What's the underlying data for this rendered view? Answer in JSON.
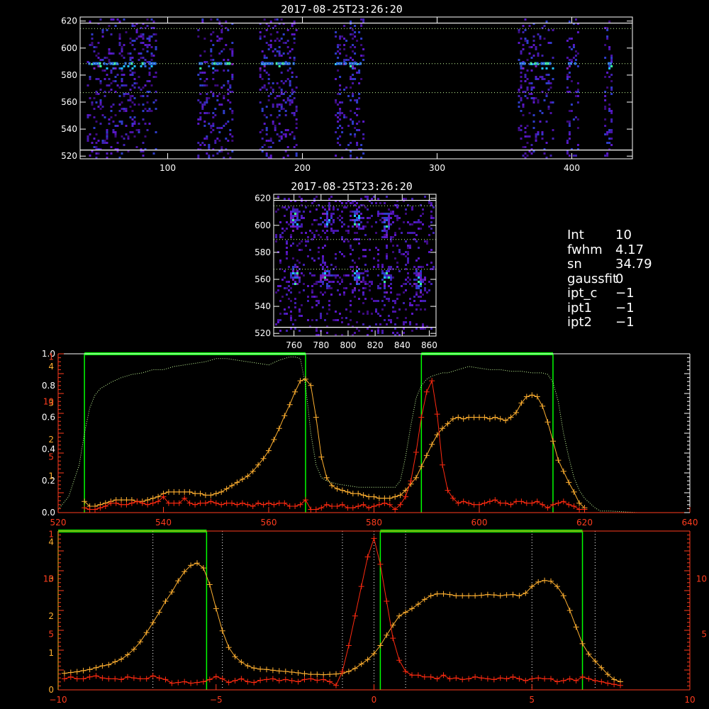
{
  "colors": {
    "background": "#000000",
    "axes": "#ffffff",
    "axes_red": "#ff3c1e",
    "series_red": "#ff2a10",
    "series_orange": "#ffb030",
    "band_green": "#00ff00",
    "dotted_green": "#c8ff9c",
    "dotted_white": "#ffffff"
  },
  "info": [
    {
      "key": "Int",
      "value": "10"
    },
    {
      "key": "fwhm",
      "value": "4.17"
    },
    {
      "key": "sn",
      "value": "34.79"
    },
    {
      "key": "gaussfit",
      "value": "0"
    },
    {
      "key": "ipt_c",
      "value": "−1"
    },
    {
      "key": "ipt1",
      "value": "−1"
    },
    {
      "key": "ipt2",
      "value": "−1"
    }
  ],
  "chart_data": [
    {
      "type": "heatmap",
      "title": "2017-08-25T23:26:20",
      "xlim": [
        35,
        445
      ],
      "ylim": [
        518,
        623
      ],
      "xticks": [
        "100",
        "200",
        "300",
        "400"
      ],
      "yticks": [
        "520",
        "540",
        "560",
        "580",
        "600",
        "620"
      ],
      "hlines_solid": [
        618.5,
        524.5
      ],
      "hlines_dotted": [
        614.5,
        588.5,
        567
      ],
      "active_columns": [
        [
          40,
          92
        ],
        [
          122,
          148
        ],
        [
          168,
          196
        ],
        [
          224,
          245
        ],
        [
          360,
          386
        ],
        [
          396,
          404
        ],
        [
          424,
          430
        ]
      ],
      "bright_row": 587.5
    },
    {
      "type": "heatmap",
      "title": "2017-08-25T23:26:20",
      "xlim": [
        745,
        865
      ],
      "ylim": [
        518,
        623
      ],
      "xticks": [
        "760",
        "780",
        "800",
        "820",
        "840",
        "860"
      ],
      "yticks": [
        "520",
        "540",
        "560",
        "580",
        "600",
        "620"
      ],
      "hlines_solid": [
        618.5,
        524.5
      ],
      "hlines_dotted": [
        614.5,
        589.5,
        567.5
      ]
    },
    {
      "type": "line",
      "xlim": [
        520,
        640
      ],
      "xticks": [
        "520",
        "540",
        "560",
        "580",
        "600",
        "620",
        "640"
      ],
      "left_axis_ticks": [
        "0.0",
        "0.2",
        "0.4",
        "0.6",
        "0.8",
        "1.0"
      ],
      "left_axis_ticks_orange": [
        "1",
        "2",
        "3",
        "4"
      ],
      "left_axis_ticks_red": [
        "5",
        "10",
        "1"
      ],
      "green_band_1": [
        525,
        567
      ],
      "green_band_2": [
        589,
        614
      ],
      "series": [
        {
          "color": "orange",
          "x": [
            525,
            526,
            527,
            528,
            529,
            530,
            531,
            532,
            533,
            534,
            535,
            536,
            537,
            538,
            539,
            540,
            541,
            542,
            543,
            544,
            545,
            546,
            547,
            548,
            549,
            550,
            551,
            552,
            553,
            554,
            555,
            556,
            557,
            558,
            559,
            560,
            561,
            562,
            563,
            564,
            565,
            566,
            567,
            568,
            569,
            570,
            571,
            572,
            573,
            574,
            575,
            576,
            577,
            578,
            579,
            580,
            581,
            582,
            583,
            584,
            585,
            586,
            587,
            588,
            589,
            590,
            591,
            592,
            593,
            594,
            595,
            596,
            597,
            598,
            599,
            600,
            601,
            602,
            603,
            604,
            605,
            606,
            607,
            608,
            609,
            610,
            611,
            612,
            613,
            614,
            615,
            616,
            617,
            618,
            619,
            620
          ],
          "y": [
            0.07,
            0.04,
            0.04,
            0.05,
            0.06,
            0.07,
            0.08,
            0.08,
            0.08,
            0.08,
            0.07,
            0.07,
            0.08,
            0.09,
            0.1,
            0.12,
            0.13,
            0.13,
            0.13,
            0.13,
            0.13,
            0.12,
            0.12,
            0.11,
            0.11,
            0.12,
            0.13,
            0.15,
            0.17,
            0.19,
            0.21,
            0.23,
            0.26,
            0.3,
            0.34,
            0.39,
            0.46,
            0.53,
            0.61,
            0.68,
            0.76,
            0.83,
            0.84,
            0.8,
            0.6,
            0.35,
            0.22,
            0.17,
            0.15,
            0.14,
            0.13,
            0.12,
            0.12,
            0.11,
            0.1,
            0.1,
            0.09,
            0.09,
            0.09,
            0.1,
            0.11,
            0.14,
            0.18,
            0.22,
            0.29,
            0.36,
            0.43,
            0.49,
            0.53,
            0.56,
            0.59,
            0.6,
            0.59,
            0.6,
            0.6,
            0.6,
            0.6,
            0.59,
            0.6,
            0.59,
            0.58,
            0.6,
            0.63,
            0.69,
            0.73,
            0.74,
            0.73,
            0.67,
            0.57,
            0.45,
            0.33,
            0.26,
            0.19,
            0.13,
            0.06,
            0.03
          ]
        },
        {
          "color": "red",
          "x": [
            525,
            526,
            527,
            528,
            529,
            530,
            531,
            532,
            533,
            534,
            535,
            536,
            537,
            538,
            539,
            540,
            541,
            542,
            543,
            544,
            545,
            546,
            547,
            548,
            549,
            550,
            551,
            552,
            553,
            554,
            555,
            556,
            557,
            558,
            559,
            560,
            561,
            562,
            563,
            564,
            565,
            566,
            567,
            568,
            569,
            570,
            571,
            572,
            573,
            574,
            575,
            576,
            577,
            578,
            579,
            580,
            581,
            582,
            583,
            584,
            585,
            586,
            587,
            588,
            589,
            590,
            591,
            592,
            593,
            594,
            595,
            596,
            597,
            598,
            599,
            600,
            601,
            602,
            603,
            604,
            605,
            606,
            607,
            608,
            609,
            610,
            611,
            612,
            613,
            614,
            615,
            616,
            617,
            618,
            619,
            620
          ],
          "y": [
            0.03,
            0.02,
            0.02,
            0.03,
            0.04,
            0.06,
            0.06,
            0.05,
            0.05,
            0.06,
            0.07,
            0.06,
            0.05,
            0.06,
            0.07,
            0.1,
            0.06,
            0.06,
            0.06,
            0.09,
            0.06,
            0.05,
            0.06,
            0.06,
            0.07,
            0.06,
            0.05,
            0.06,
            0.06,
            0.05,
            0.06,
            0.05,
            0.04,
            0.06,
            0.05,
            0.06,
            0.05,
            0.06,
            0.06,
            0.04,
            0.04,
            0.05,
            0.08,
            0.02,
            0.02,
            0.03,
            0.05,
            0.04,
            0.04,
            0.05,
            0.03,
            0.03,
            0.04,
            0.05,
            0.03,
            0.04,
            0.05,
            0.06,
            0.05,
            0.02,
            0.05,
            0.1,
            0.2,
            0.38,
            0.6,
            0.76,
            0.83,
            0.62,
            0.3,
            0.14,
            0.09,
            0.06,
            0.07,
            0.06,
            0.05,
            0.05,
            0.06,
            0.07,
            0.08,
            0.06,
            0.06,
            0.05,
            0.07,
            0.07,
            0.06,
            0.06,
            0.07,
            0.05,
            0.03,
            0.05,
            0.06,
            0.07,
            0.05,
            0.04,
            0.02,
            0.02
          ]
        },
        {
          "color": "dotted",
          "x": [
            520,
            522,
            524,
            525,
            526,
            527,
            528,
            529,
            530,
            532,
            534,
            536,
            538,
            540,
            542,
            544,
            546,
            548,
            550,
            552,
            554,
            556,
            558,
            560,
            562,
            564,
            565,
            566,
            567,
            568,
            569,
            570,
            571,
            572,
            573,
            575,
            577,
            580,
            582,
            584,
            585,
            586,
            587,
            588,
            589,
            590,
            591,
            592,
            593,
            594,
            596,
            598,
            600,
            602,
            604,
            606,
            608,
            610,
            612,
            613,
            614,
            615,
            616,
            617,
            618,
            619,
            620,
            621,
            622,
            623,
            625,
            630,
            635,
            640
          ],
          "y": [
            0.02,
            0.1,
            0.3,
            0.5,
            0.66,
            0.74,
            0.78,
            0.8,
            0.82,
            0.85,
            0.87,
            0.88,
            0.9,
            0.9,
            0.92,
            0.93,
            0.94,
            0.95,
            0.97,
            0.97,
            0.96,
            0.95,
            0.94,
            0.93,
            0.96,
            0.98,
            0.98,
            0.97,
            0.8,
            0.5,
            0.3,
            0.22,
            0.2,
            0.19,
            0.18,
            0.17,
            0.16,
            0.16,
            0.16,
            0.16,
            0.2,
            0.35,
            0.55,
            0.72,
            0.8,
            0.84,
            0.86,
            0.87,
            0.88,
            0.88,
            0.9,
            0.92,
            0.91,
            0.9,
            0.9,
            0.89,
            0.89,
            0.88,
            0.88,
            0.87,
            0.82,
            0.7,
            0.5,
            0.35,
            0.22,
            0.14,
            0.09,
            0.06,
            0.03,
            0.01,
            0.01,
            0.0,
            0.0,
            0.0
          ]
        }
      ]
    },
    {
      "type": "line",
      "xlim": [
        -10,
        10
      ],
      "xticks": [
        "−10",
        "−5",
        "0",
        "5",
        "10"
      ],
      "left_axis_ticks": [
        "0",
        "1",
        "2",
        "3",
        "4"
      ],
      "left_axis_ticks_red": [
        "5",
        "10",
        "1"
      ],
      "right_axis_ticks_red": [
        "5",
        "10"
      ],
      "green_band_1": [
        -10,
        -5.3
      ],
      "green_band_2": [
        0.2,
        6.6
      ],
      "vlines_dotted": [
        -7,
        -4.8,
        -1,
        0,
        1,
        5,
        7
      ],
      "series": [
        {
          "color": "orange",
          "x": [
            -9.8,
            -9.6,
            -9.4,
            -9.2,
            -9.0,
            -8.8,
            -8.6,
            -8.4,
            -8.2,
            -8.0,
            -7.8,
            -7.6,
            -7.4,
            -7.2,
            -7.0,
            -6.8,
            -6.6,
            -6.4,
            -6.2,
            -6.0,
            -5.8,
            -5.6,
            -5.4,
            -5.2,
            -5.0,
            -4.8,
            -4.6,
            -4.4,
            -4.2,
            -4.0,
            -3.8,
            -3.6,
            -3.4,
            -3.2,
            -3.0,
            -2.8,
            -2.6,
            -2.4,
            -2.2,
            -2.0,
            -1.8,
            -1.6,
            -1.4,
            -1.2,
            -1.0,
            -0.8,
            -0.6,
            -0.4,
            -0.2,
            0.0,
            0.2,
            0.4,
            0.6,
            0.8,
            1.0,
            1.2,
            1.4,
            1.6,
            1.8,
            2.0,
            2.2,
            2.4,
            2.6,
            2.8,
            3.0,
            3.2,
            3.4,
            3.6,
            3.8,
            4.0,
            4.2,
            4.4,
            4.6,
            4.8,
            5.0,
            5.2,
            5.4,
            5.6,
            5.8,
            6.0,
            6.2,
            6.4,
            6.6,
            6.8,
            7.0,
            7.2,
            7.4,
            7.6,
            7.8
          ],
          "y": [
            0.45,
            0.47,
            0.49,
            0.52,
            0.55,
            0.6,
            0.65,
            0.68,
            0.76,
            0.83,
            0.95,
            1.1,
            1.3,
            1.55,
            1.82,
            2.1,
            2.4,
            2.65,
            2.95,
            3.2,
            3.37,
            3.43,
            3.3,
            2.85,
            2.2,
            1.6,
            1.15,
            0.9,
            0.75,
            0.65,
            0.59,
            0.56,
            0.55,
            0.53,
            0.51,
            0.5,
            0.48,
            0.46,
            0.44,
            0.42,
            0.42,
            0.41,
            0.42,
            0.43,
            0.45,
            0.5,
            0.58,
            0.7,
            0.82,
            0.98,
            1.2,
            1.48,
            1.75,
            2.0,
            2.1,
            2.2,
            2.32,
            2.45,
            2.55,
            2.6,
            2.6,
            2.58,
            2.55,
            2.55,
            2.55,
            2.55,
            2.56,
            2.58,
            2.57,
            2.55,
            2.57,
            2.58,
            2.55,
            2.62,
            2.8,
            2.92,
            2.96,
            2.94,
            2.8,
            2.55,
            2.15,
            1.7,
            1.25,
            0.97,
            0.78,
            0.6,
            0.42,
            0.28,
            0.22
          ]
        },
        {
          "color": "red",
          "x": [
            -9.8,
            -9.6,
            -9.4,
            -9.2,
            -9.0,
            -8.8,
            -8.6,
            -8.4,
            -8.2,
            -8.0,
            -7.8,
            -7.6,
            -7.4,
            -7.2,
            -7.0,
            -6.8,
            -6.6,
            -6.4,
            -6.2,
            -6.0,
            -5.8,
            -5.6,
            -5.4,
            -5.2,
            -5.0,
            -4.8,
            -4.6,
            -4.4,
            -4.2,
            -4.0,
            -3.8,
            -3.6,
            -3.4,
            -3.2,
            -3.0,
            -2.8,
            -2.6,
            -2.4,
            -2.2,
            -2.0,
            -1.8,
            -1.6,
            -1.4,
            -1.2,
            -1.0,
            -0.8,
            -0.6,
            -0.4,
            -0.2,
            0.0,
            0.2,
            0.4,
            0.6,
            0.8,
            1.0,
            1.2,
            1.4,
            1.6,
            1.8,
            2.0,
            2.2,
            2.4,
            2.6,
            2.8,
            3.0,
            3.2,
            3.4,
            3.6,
            3.8,
            4.0,
            4.2,
            4.4,
            4.6,
            4.8,
            5.0,
            5.2,
            5.4,
            5.6,
            5.8,
            6.0,
            6.2,
            6.4,
            6.6,
            6.8,
            7.0,
            7.2,
            7.4,
            7.6,
            7.8
          ],
          "y": [
            0.3,
            0.35,
            0.3,
            0.3,
            0.35,
            0.38,
            0.32,
            0.3,
            0.3,
            0.28,
            0.35,
            0.32,
            0.3,
            0.3,
            0.38,
            0.32,
            0.28,
            0.18,
            0.2,
            0.22,
            0.18,
            0.2,
            0.22,
            0.28,
            0.36,
            0.3,
            0.2,
            0.25,
            0.3,
            0.22,
            0.2,
            0.26,
            0.28,
            0.3,
            0.25,
            0.28,
            0.25,
            0.22,
            0.28,
            0.3,
            0.26,
            0.28,
            0.22,
            0.12,
            0.5,
            1.2,
            2.0,
            2.8,
            3.6,
            4.1,
            3.4,
            2.4,
            1.4,
            0.8,
            0.5,
            0.4,
            0.4,
            0.35,
            0.35,
            0.3,
            0.4,
            0.3,
            0.32,
            0.28,
            0.3,
            0.35,
            0.32,
            0.3,
            0.28,
            0.32,
            0.3,
            0.35,
            0.3,
            0.25,
            0.3,
            0.32,
            0.3,
            0.3,
            0.22,
            0.25,
            0.3,
            0.25,
            0.35,
            0.3,
            0.25,
            0.22,
            0.18,
            0.15,
            0.12
          ]
        }
      ]
    }
  ]
}
